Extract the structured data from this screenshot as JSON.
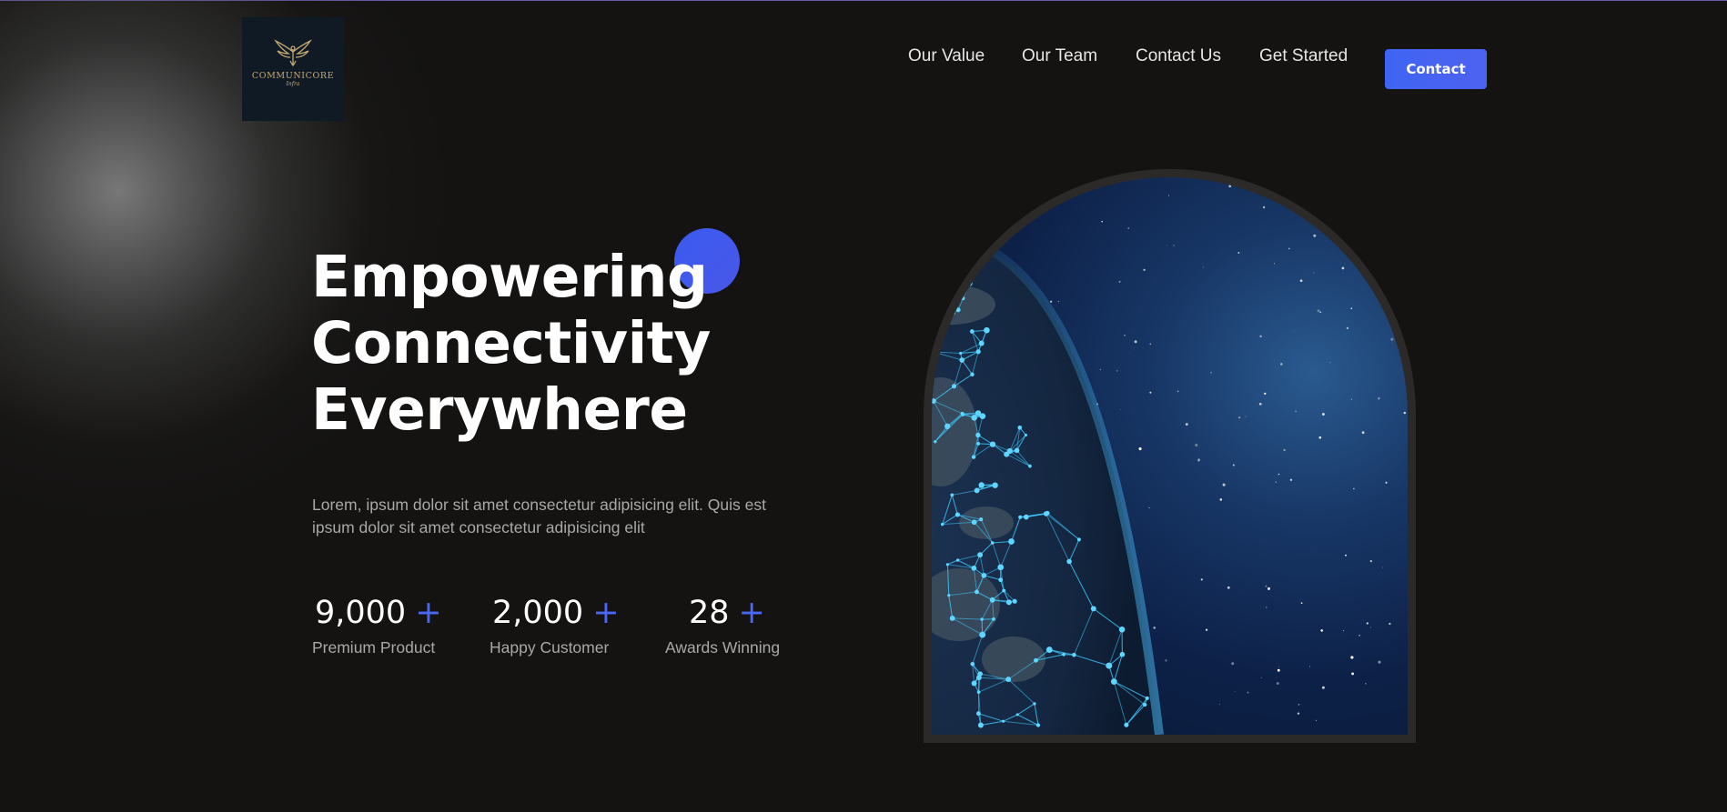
{
  "brand": {
    "logo_name": "COMMUNICORE",
    "logo_sub": "Infra",
    "accent_color": "#4361ee",
    "background_color": "#141312"
  },
  "nav": {
    "items": [
      {
        "label": "Our Value"
      },
      {
        "label": "Our Team"
      },
      {
        "label": "Contact Us"
      },
      {
        "label": "Get Started"
      }
    ],
    "cta_label": "Contact"
  },
  "hero": {
    "headline": [
      "Empowering",
      "Connectivity",
      "Everywhere"
    ],
    "description": "Lorem, ipsum dolor sit amet consectetur adipisicing elit. Quis est ipsum dolor sit amet consectetur adipisicing elit",
    "image_icon": "earth-network-image"
  },
  "stats": [
    {
      "value": "9,000",
      "suffix": "+",
      "label": "Premium Product"
    },
    {
      "value": "2,000",
      "suffix": "+",
      "label": "Happy Customer"
    },
    {
      "value": "28",
      "suffix": "+",
      "label": "Awards Winning"
    }
  ]
}
